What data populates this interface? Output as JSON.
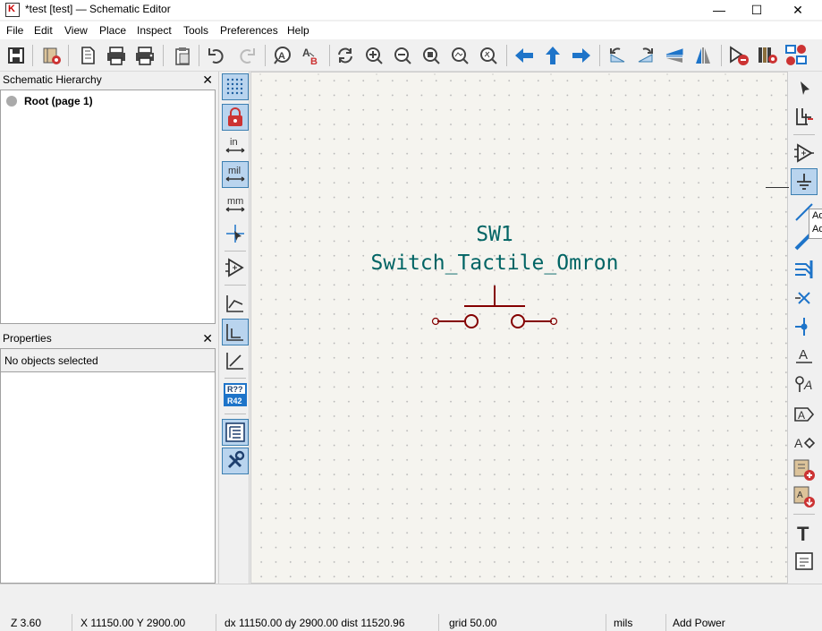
{
  "window": {
    "title": "*test [test] — Schematic Editor",
    "minimize_glyph": "—",
    "maximize_glyph": "☐",
    "close_glyph": "✕"
  },
  "menu": [
    "File",
    "Edit",
    "View",
    "Place",
    "Inspect",
    "Tools",
    "Preferences",
    "Help"
  ],
  "toolbar": {
    "icons": [
      "schematic-setup-icon",
      "symbol-editor-icon",
      "page-settings-icon",
      "print-icon",
      "plot-icon",
      "paste-icon",
      "undo-icon",
      "redo-icon",
      "find-icon",
      "find-replace-icon",
      "refresh-icon",
      "zoom-in-icon",
      "zoom-out-icon",
      "zoom-fit-icon",
      "zoom-objects-icon",
      "zoom-selection-icon",
      "navigate-back-icon",
      "navigate-up-icon",
      "navigate-forward-icon",
      "rotate-ccw-icon",
      "rotate-cw-icon",
      "mirror-vertical-icon",
      "mirror-horizontal-icon",
      "erc-icon",
      "bom-icon",
      "annotate-icon"
    ]
  },
  "hierarchy": {
    "title": "Schematic Hierarchy",
    "close_glyph": "✕",
    "root_label": "Root (page 1)"
  },
  "properties": {
    "title": "Properties",
    "close_glyph": "✕",
    "status": "No objects selected"
  },
  "left_toolbar": {
    "unit_in": "in",
    "unit_mil": "mil",
    "unit_mm": "mm",
    "annotate_top": "R??",
    "annotate_bottom": "R42"
  },
  "schematic": {
    "reference": "SW1",
    "value": "Switch_Tactile_Omron",
    "colors": {
      "reference_text": "#006464",
      "symbol_body": "#840000",
      "canvas_background": "#f5f4ef"
    }
  },
  "right_toolbar": {
    "tooltip_fragment": "Ad Ad",
    "label_glyph": "A",
    "text_glyph": "T"
  },
  "status_bar": {
    "zoom": "Z 3.60",
    "cursor": "X 11150.00  Y 2900.00",
    "delta": "dx 11150.00  dy 2900.00  dist 11520.96",
    "grid": "grid 50.00",
    "units": "mils",
    "tool": "Add Power"
  }
}
